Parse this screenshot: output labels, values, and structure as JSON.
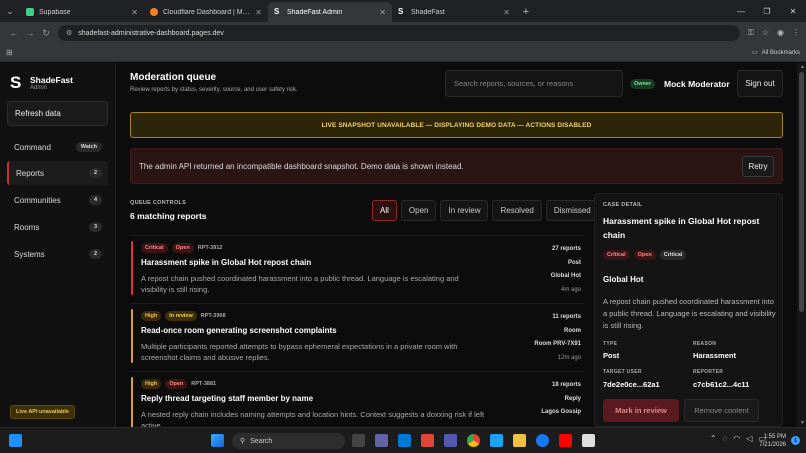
{
  "browser": {
    "tabs": [
      {
        "title": "Supabase",
        "color": "#3ecf8e"
      },
      {
        "title": "Cloudflare Dashboard | Manage",
        "color": "#f48120"
      },
      {
        "title": "ShadeFast Admin",
        "color": "#ffffff"
      },
      {
        "title": "ShadeFast",
        "color": "#ffffff"
      }
    ],
    "url": "shadefast-administrative-dashboard.pages.dev",
    "all_bookmarks": "All Bookmarks"
  },
  "sidebar": {
    "brand_name": "ShadeFast",
    "brand_sub": "Admin",
    "refresh_label": "Refresh data",
    "items": [
      {
        "label": "Command",
        "badge": "Watch"
      },
      {
        "label": "Reports",
        "badge": "2"
      },
      {
        "label": "Communities",
        "badge": "4"
      },
      {
        "label": "Rooms",
        "badge": "3"
      },
      {
        "label": "Systems",
        "badge": "2"
      }
    ],
    "live_status": "Live API unavailable"
  },
  "header": {
    "title": "Moderation queue",
    "subtitle": "Review reports by status, severity, source, and user safety risk.",
    "search_placeholder": "Search reports, sources, or reasons",
    "owner_badge": "Owner",
    "moderator_name": "Mock Moderator",
    "signout_label": "Sign out"
  },
  "banners": {
    "warning": "LIVE SNAPSHOT UNAVAILABLE — DISPLAYING DEMO DATA — ACTIONS DISABLED",
    "error": "The admin API returned an incompatible dashboard snapshot. Demo data is shown instead.",
    "retry_label": "Retry"
  },
  "queue": {
    "label": "QUEUE CONTROLS",
    "count": "6 matching reports",
    "filters": [
      "All",
      "Open",
      "In review",
      "Resolved",
      "Dismissed"
    ],
    "active_filter": "All",
    "items": [
      {
        "severity": "Critical",
        "status": "Open",
        "id": "RPT-3912",
        "title": "Harassment spike in Global Hot repost chain",
        "desc": "A repost chain pushed coordinated harassment into a public thread. Language is escalating and visibility is still rising.",
        "reports": "27 reports",
        "type": "Post",
        "source": "Global Hot",
        "age": "4m ago",
        "bar_color": "#e0303a"
      },
      {
        "severity": "High",
        "status": "In review",
        "id": "RPT-3908",
        "title": "Read-once room generating screenshot complaints",
        "desc": "Multiple participants reported attempts to bypass ephemeral expectations in a private room with screenshot claims and abusive replies.",
        "reports": "11 reports",
        "type": "Room",
        "source": "Room PRV-7X91",
        "age": "12m ago",
        "bar_color": "#e0a030"
      },
      {
        "severity": "High",
        "status": "Open",
        "id": "RPT-3881",
        "title": "Reply thread targeting staff member by name",
        "desc": "A nested reply chain includes naming attempts and location hints. Context suggests a doxxing risk if left active.",
        "reports": "18 reports",
        "type": "Reply",
        "source": "Lagos Gossip",
        "age": "",
        "bar_color": "#e0a030"
      }
    ]
  },
  "detail": {
    "label": "CASE DETAIL",
    "title": "Harassment spike in Global Hot repost chain",
    "pills": [
      "Critical",
      "Open",
      "Critical"
    ],
    "community": "Global Hot",
    "desc": "A repost chain pushed coordinated harassment into a public thread. Language is escalating and visibility is still rising.",
    "type_label": "TYPE",
    "type_value": "Post",
    "reason_label": "REASON",
    "reason_value": "Harassment",
    "target_label": "TARGET USER",
    "target_value": "7de2e0ce...62a1",
    "reporter_label": "REPORTER",
    "reporter_value": "c7cb61c2...4c11",
    "btn_review": "Mark in review",
    "btn_remove": "Remove content"
  },
  "taskbar": {
    "search": "Search",
    "time": "1:55 PM",
    "date": "7/21/2026",
    "notif": "1"
  }
}
